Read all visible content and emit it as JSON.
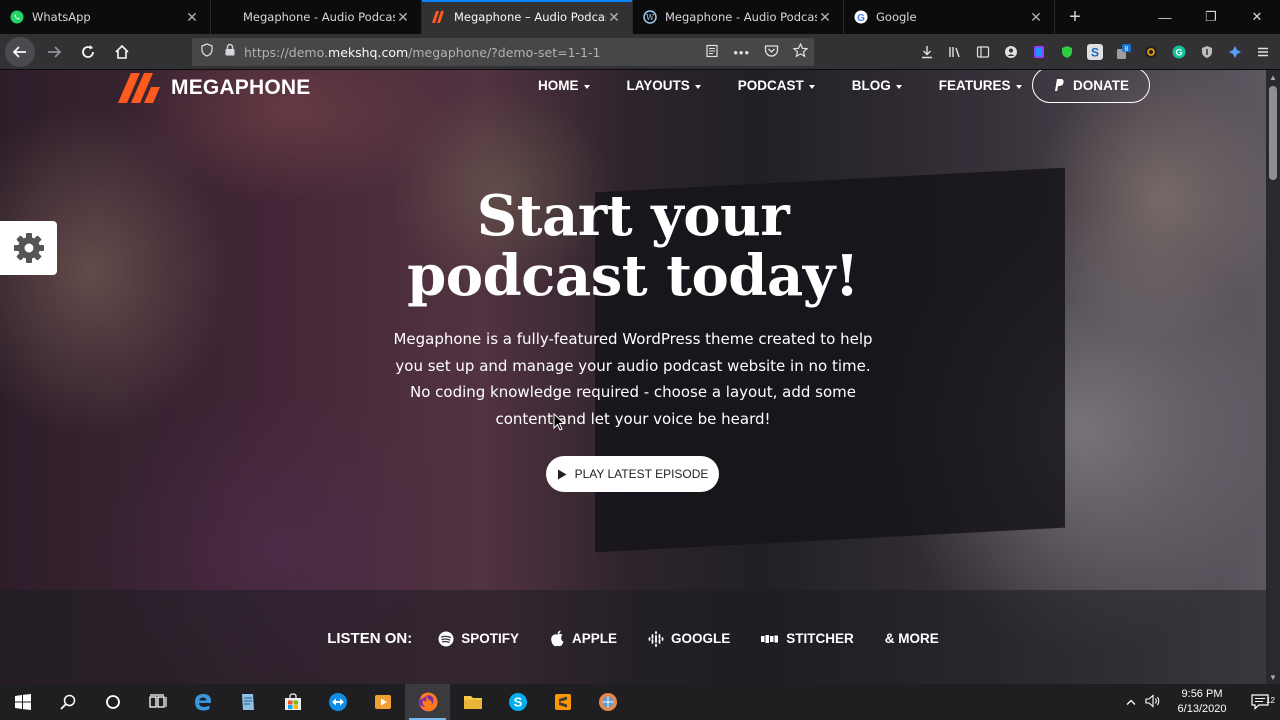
{
  "browser": {
    "tabs": [
      {
        "title": "WhatsApp",
        "icon": "whatsapp-icon",
        "active": false
      },
      {
        "title": "Megaphone - Audio Podcast W",
        "icon": "blank-icon",
        "active": false
      },
      {
        "title": "Megaphone – Audio Podcast W",
        "icon": "megaphone-icon",
        "active": true
      },
      {
        "title": "Megaphone - Audio Podcast W",
        "icon": "wordpress-icon",
        "active": false
      },
      {
        "title": "Google",
        "icon": "google-icon",
        "active": false
      }
    ],
    "url_prefix": "https://demo.",
    "url_domain": "mekshq.com",
    "url_path": "/megaphone/?demo-set=1-1-1",
    "accent": "#0a84ff"
  },
  "site": {
    "logo_text": "MEGAPHONE",
    "brand_color": "#ff5a1f",
    "nav": [
      "HOME",
      "LAYOUTS",
      "PODCAST",
      "BLOG",
      "FEATURES"
    ],
    "donate_label": "DONATE",
    "headline_line1": "Start your",
    "headline_line2": "podcast today!",
    "intro": "Megaphone is a fully-featured WordPress theme created to help you set up and manage your audio podcast website in no time. No coding knowledge required - choose a layout, add some content and let your voice be heard!",
    "play_label": "PLAY LATEST EPISODE",
    "listen_label": "LISTEN ON:",
    "platforms": [
      {
        "name": "SPOTIFY",
        "icon": "spotify-icon"
      },
      {
        "name": "APPLE",
        "icon": "apple-icon"
      },
      {
        "name": "GOOGLE",
        "icon": "google-podcasts-icon"
      },
      {
        "name": "STITCHER",
        "icon": "stitcher-icon"
      },
      {
        "name": "& MORE",
        "icon": ""
      }
    ]
  },
  "taskbar": {
    "time": "9:56 PM",
    "date": "6/13/2020",
    "notification_count": "12"
  }
}
